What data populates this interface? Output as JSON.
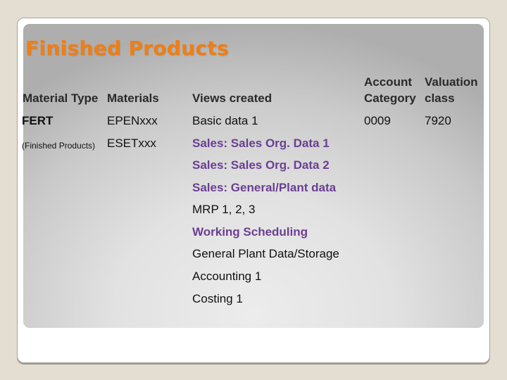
{
  "slide": {
    "title": "Finished Products",
    "colors": {
      "title": "#ee7e17",
      "highlight_text": "#6b3f92",
      "background": "#e4ddd2"
    }
  },
  "table": {
    "headers": {
      "material_type": "Material Type",
      "materials": "Materials",
      "views_created": "Views created",
      "account_category_line1": "Account",
      "account_category_line2": "Category",
      "valuation_class_line1": "Valuation",
      "valuation_class_line2": "class"
    },
    "material_type": {
      "code": "FERT",
      "description": "(Finished Products)"
    },
    "materials": [
      "EPENxxx",
      "ESETxxx"
    ],
    "views": [
      {
        "label": "Basic data 1",
        "highlighted": false
      },
      {
        "label": "Sales: Sales Org. Data 1",
        "highlighted": true
      },
      {
        "label": "Sales: Sales Org. Data 2",
        "highlighted": true
      },
      {
        "label": "Sales: General/Plant data",
        "highlighted": true
      },
      {
        "label": "MRP 1, 2, 3",
        "highlighted": false
      },
      {
        "label": "Working Scheduling",
        "highlighted": true
      },
      {
        "label": "General Plant Data/Storage",
        "highlighted": false
      },
      {
        "label": "Accounting 1",
        "highlighted": false
      },
      {
        "label": "Costing 1",
        "highlighted": false
      }
    ],
    "account_category": "0009",
    "valuation_class": "7920"
  }
}
